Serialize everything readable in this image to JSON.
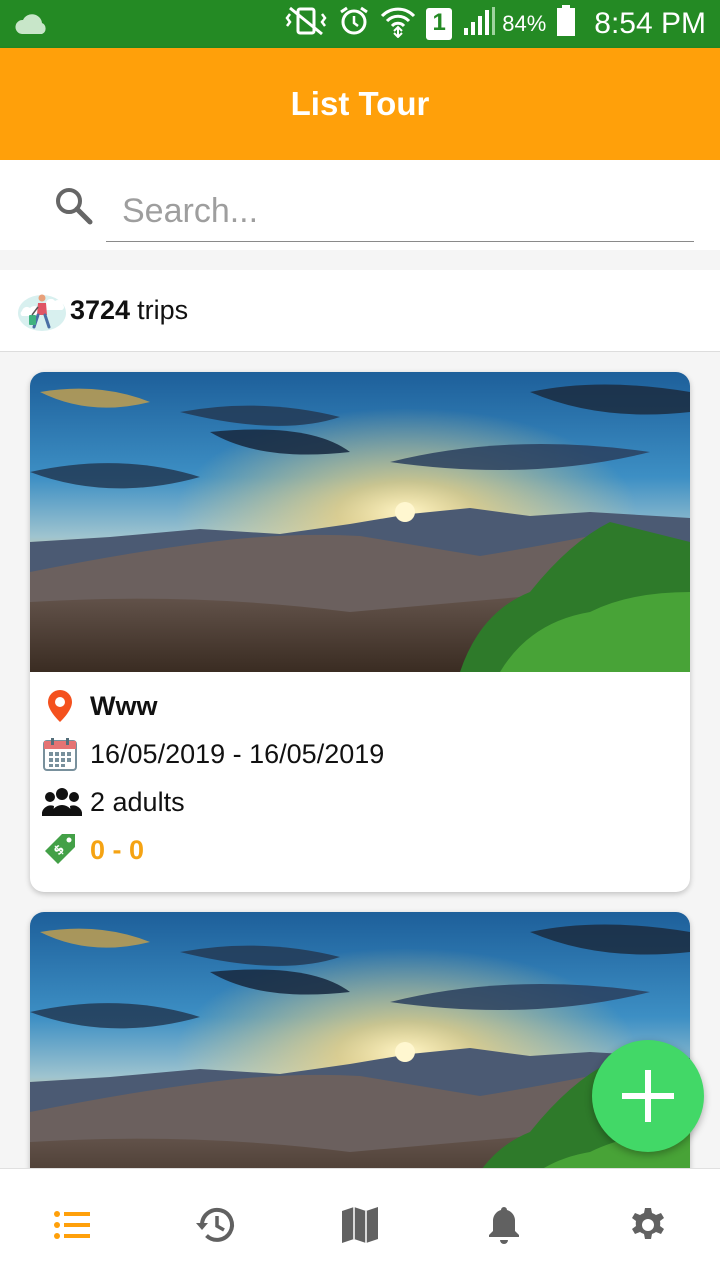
{
  "status_bar": {
    "battery_percent": "84%",
    "time": "8:54 PM",
    "sim_slot": "1",
    "icons": [
      "cloud-icon",
      "vibrate-icon",
      "alarm-icon",
      "wifi-icon",
      "sim-icon",
      "signal-icon",
      "battery-icon"
    ]
  },
  "app_bar": {
    "title": "List Tour"
  },
  "search": {
    "placeholder": "Search..."
  },
  "trips": {
    "count": "3724",
    "label": "trips"
  },
  "cards": [
    {
      "destination": "Www",
      "dates": "16/05/2019 - 16/05/2019",
      "guests": "2 adults",
      "price": "0 - 0"
    }
  ],
  "bottom_nav": {
    "items": [
      {
        "id": "list",
        "icon": "list-icon",
        "active": true
      },
      {
        "id": "history",
        "icon": "history-icon",
        "active": false
      },
      {
        "id": "map",
        "icon": "map-icon",
        "active": false
      },
      {
        "id": "notifications",
        "icon": "bell-icon",
        "active": false
      },
      {
        "id": "settings",
        "icon": "gear-icon",
        "active": false
      }
    ]
  },
  "colors": {
    "status_bar": "#248a24",
    "app_bar": "#ffa00a",
    "accent": "#f5a313",
    "fab": "#42d867",
    "nav_active": "#ffa00a",
    "nav_inactive": "#616161"
  }
}
